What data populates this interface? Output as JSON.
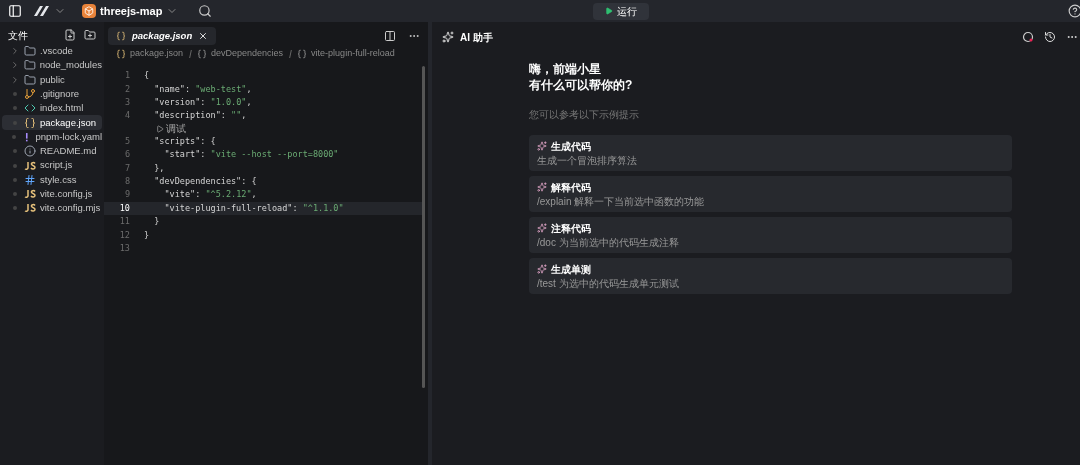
{
  "topbar": {
    "project": "threejs-map",
    "run_button": "运行"
  },
  "explorer": {
    "title": "文件",
    "files": [
      {
        "name": ".vscode",
        "kind": "folder",
        "selected": false
      },
      {
        "name": "node_modules",
        "kind": "folder",
        "selected": false
      },
      {
        "name": "public",
        "kind": "folder",
        "selected": false
      },
      {
        "name": ".gitignore",
        "kind": "git",
        "selected": false
      },
      {
        "name": "index.html",
        "kind": "html",
        "selected": false
      },
      {
        "name": "package.json",
        "kind": "json",
        "selected": true
      },
      {
        "name": "pnpm-lock.yaml",
        "kind": "yaml",
        "selected": false
      },
      {
        "name": "README.md",
        "kind": "info",
        "selected": false
      },
      {
        "name": "script.js",
        "kind": "js",
        "selected": false
      },
      {
        "name": "style.css",
        "kind": "css",
        "selected": false
      },
      {
        "name": "vite.config.js",
        "kind": "js",
        "selected": false
      },
      {
        "name": "vite.config.mjs",
        "kind": "js",
        "selected": false
      }
    ]
  },
  "editor": {
    "tab": "package.json",
    "breadcrumb": [
      "package.json",
      "devDependencies",
      "vite-plugin-full-reload"
    ],
    "lines": [
      {
        "kind": "code",
        "number": "1",
        "current": false,
        "tokens": [
          {
            "t": "{",
            "kind": "punct"
          }
        ]
      },
      {
        "kind": "code",
        "number": "2",
        "current": false,
        "tokens": [
          {
            "t": "  \"name\"",
            "kind": "key"
          },
          {
            "t": ": ",
            "kind": "punct"
          },
          {
            "t": "\"web-test\"",
            "kind": "string"
          },
          {
            "t": ",",
            "kind": "punct"
          }
        ]
      },
      {
        "kind": "code",
        "number": "3",
        "current": false,
        "tokens": [
          {
            "t": "  \"version\"",
            "kind": "key"
          },
          {
            "t": ": ",
            "kind": "punct"
          },
          {
            "t": "\"1.0.0\"",
            "kind": "string"
          },
          {
            "t": ",",
            "kind": "punct"
          }
        ]
      },
      {
        "kind": "code",
        "number": "4",
        "current": false,
        "tokens": [
          {
            "t": "  \"description\"",
            "kind": "key"
          },
          {
            "t": ": ",
            "kind": "punct"
          },
          {
            "t": "\"\"",
            "kind": "string"
          },
          {
            "t": ",",
            "kind": "punct"
          }
        ]
      },
      {
        "kind": "codelens",
        "text": "调试"
      },
      {
        "kind": "code",
        "number": "5",
        "current": false,
        "tokens": [
          {
            "t": "  \"scripts\"",
            "kind": "key"
          },
          {
            "t": ": {",
            "kind": "punct"
          }
        ]
      },
      {
        "kind": "code",
        "number": "6",
        "current": false,
        "tokens": [
          {
            "t": "    \"start\"",
            "kind": "key"
          },
          {
            "t": ": ",
            "kind": "punct"
          },
          {
            "t": "\"vite --host --port=8000\"",
            "kind": "string"
          }
        ]
      },
      {
        "kind": "code",
        "number": "7",
        "current": false,
        "tokens": [
          {
            "t": "  },",
            "kind": "punct"
          }
        ]
      },
      {
        "kind": "code",
        "number": "8",
        "current": false,
        "tokens": [
          {
            "t": "  \"devDependencies\"",
            "kind": "key"
          },
          {
            "t": ": {",
            "kind": "punct"
          }
        ]
      },
      {
        "kind": "code",
        "number": "9",
        "current": false,
        "tokens": [
          {
            "t": "    \"vite\"",
            "kind": "key"
          },
          {
            "t": ": ",
            "kind": "punct"
          },
          {
            "t": "\"^5.2.12\"",
            "kind": "string"
          },
          {
            "t": ",",
            "kind": "punct"
          }
        ]
      },
      {
        "kind": "code",
        "number": "10",
        "current": true,
        "tokens": [
          {
            "t": "    \"vite-plugin-full-reload\"",
            "kind": "key"
          },
          {
            "t": ": ",
            "kind": "punct"
          },
          {
            "t": "\"^1.1.0\"",
            "kind": "string"
          }
        ]
      },
      {
        "kind": "code",
        "number": "11",
        "current": false,
        "tokens": [
          {
            "t": "  }",
            "kind": "punct"
          }
        ]
      },
      {
        "kind": "code",
        "number": "12",
        "current": false,
        "tokens": [
          {
            "t": "}",
            "kind": "punct"
          }
        ]
      },
      {
        "kind": "code",
        "number": "13",
        "current": false
      }
    ]
  },
  "assistant": {
    "title": "AI 助手",
    "greeting": [
      "嗨，前端小星",
      "有什么可以帮你的?"
    ],
    "hint": "您可以参考以下示例提示",
    "prompts": [
      {
        "title": "生成代码",
        "description": "生成一个冒泡排序算法"
      },
      {
        "title": "解释代码",
        "description": "/explain 解释一下当前选中函数的功能"
      },
      {
        "title": "注释代码",
        "description": "/doc 为当前选中的代码生成注释"
      },
      {
        "title": "生成单测",
        "description": "/test 为选中的代码生成单元测试"
      }
    ]
  }
}
